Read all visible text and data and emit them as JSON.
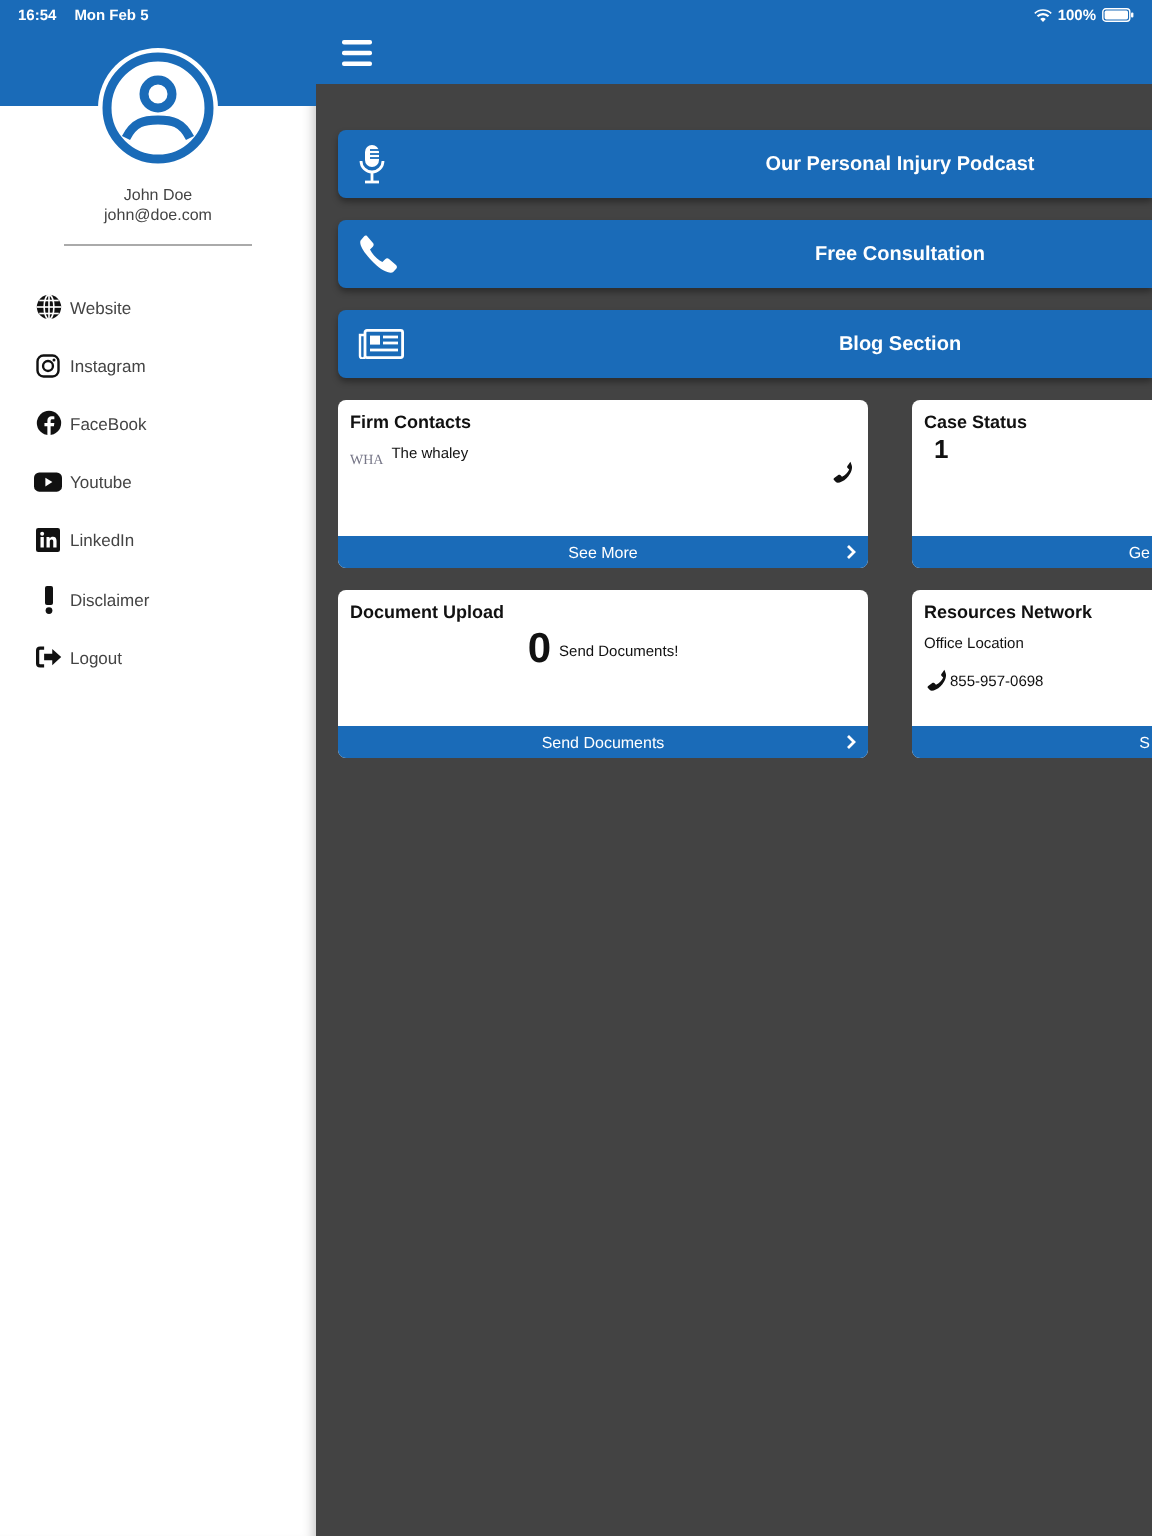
{
  "status_bar": {
    "time": "16:54",
    "date": "Mon Feb 5",
    "battery": "100%"
  },
  "sidebar": {
    "user_name": "John Doe",
    "user_email": "john@doe.com",
    "items": [
      {
        "kind": "globe",
        "label": "Website"
      },
      {
        "kind": "instagram",
        "label": "Instagram"
      },
      {
        "kind": "facebook",
        "label": "FaceBook"
      },
      {
        "kind": "youtube",
        "label": "Youtube"
      },
      {
        "kind": "linkedin",
        "label": "LinkedIn"
      },
      {
        "kind": "exclamation",
        "label": "Disclaimer"
      },
      {
        "kind": "logout",
        "label": "Logout"
      }
    ]
  },
  "actions": [
    {
      "kind": "microphone",
      "label": "Our Personal Injury Podcast"
    },
    {
      "kind": "phone",
      "label": "Free Consultation"
    },
    {
      "kind": "newspaper",
      "label": "Blog Section"
    }
  ],
  "cards": [
    {
      "kind": "contacts",
      "title": "Firm Contacts",
      "logo_text": "WHA",
      "contact_name": "The whaley",
      "footer": "See More"
    },
    {
      "kind": "status",
      "title": "Case Status",
      "count": "1",
      "footer": "Ge"
    },
    {
      "kind": "upload",
      "title": "Document Upload",
      "count": "0",
      "message": "Send Documents!",
      "footer": "Send Documents"
    },
    {
      "kind": "resources",
      "title": "Resources Network",
      "location": "Office Location",
      "phone": "855-957-0698",
      "footer": "S"
    }
  ]
}
